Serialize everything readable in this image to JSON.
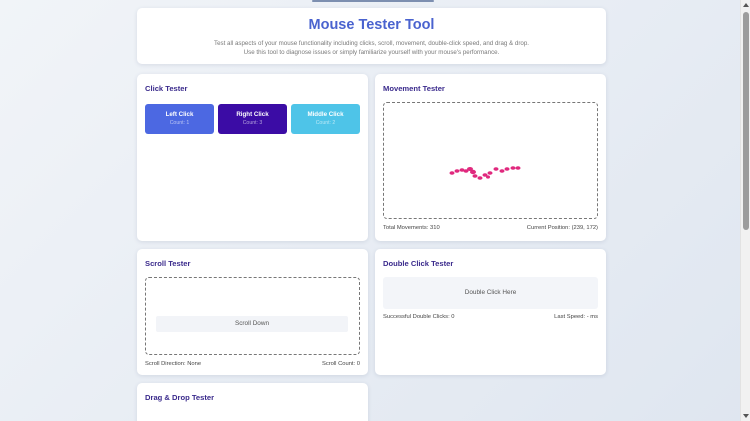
{
  "header": {
    "title": "Mouse Tester Tool",
    "description": "Test all aspects of your mouse functionality including clicks, scroll, movement, double-click speed, and drag & drop. Use this tool to diagnose issues or simply familiarize yourself with your mouse's performance."
  },
  "click_tester": {
    "title": "Click Tester",
    "buttons": [
      {
        "label": "Left Click",
        "count": "Count: 1",
        "color": "#4c68e2"
      },
      {
        "label": "Right Click",
        "count": "Count: 3",
        "color": "#3b0ca5"
      },
      {
        "label": "Middle Click",
        "count": "Count: 2",
        "color": "#4ec4e8"
      }
    ]
  },
  "movement_tester": {
    "title": "Movement Tester",
    "total_movements": "Total Movements: 310",
    "current_position": "Current Position: (239, 172)",
    "trail_color": "#e0297e"
  },
  "scroll_tester": {
    "title": "Scroll Tester",
    "area_label": "Scroll Down",
    "direction": "Scroll Direction: None",
    "count": "Scroll Count: 0"
  },
  "double_click_tester": {
    "title": "Double Click Tester",
    "area_label": "Double Click Here",
    "successful": "Successful Double Clicks: 0",
    "last_speed": "Last Speed: - ms"
  },
  "drag_drop_tester": {
    "title": "Drag & Drop Tester"
  }
}
